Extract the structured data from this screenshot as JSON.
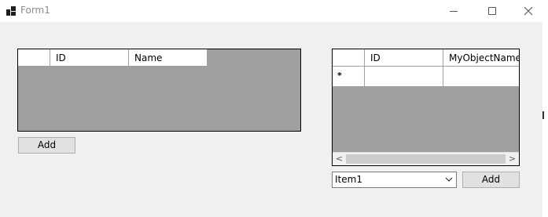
{
  "window": {
    "title": "Form1"
  },
  "grid_left": {
    "columns": [
      "",
      "ID",
      "Name"
    ]
  },
  "grid_right": {
    "columns": [
      "",
      "ID",
      "MyObjectName"
    ],
    "new_row_marker": "*",
    "scroll_left_glyph": "<",
    "scroll_right_glyph": ">"
  },
  "left_add_button": {
    "label": "Add"
  },
  "combo": {
    "selected": "Item1"
  },
  "right_add_button": {
    "label": "Add"
  },
  "icons": [
    "form-app-icon",
    "minimize-icon",
    "maximize-icon",
    "close-icon",
    "chevron-down-icon",
    "scroll-left-icon",
    "scroll-right-icon"
  ]
}
